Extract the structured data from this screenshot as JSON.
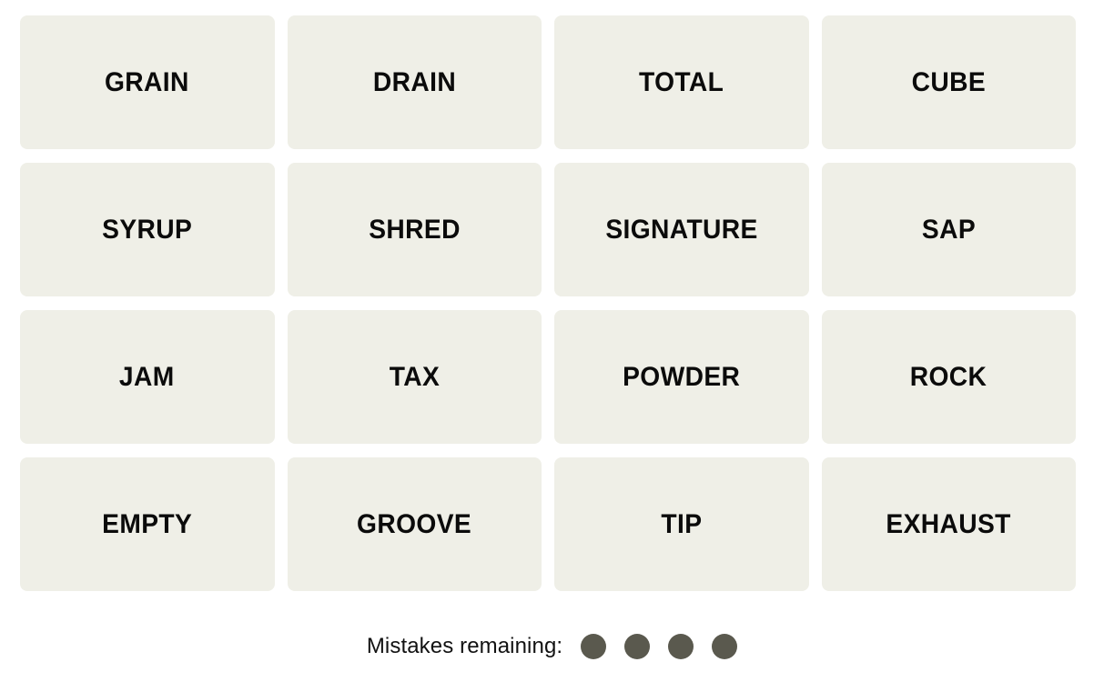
{
  "board": {
    "columns": 4,
    "rows": 4,
    "tile_color": "#EFEFE7",
    "tile_text_color": "#0B0B0B",
    "background_color": "#FFFFFF",
    "tiles": [
      {
        "word": "GRAIN"
      },
      {
        "word": "DRAIN"
      },
      {
        "word": "TOTAL"
      },
      {
        "word": "CUBE"
      },
      {
        "word": "SYRUP"
      },
      {
        "word": "SHRED"
      },
      {
        "word": "SIGNATURE"
      },
      {
        "word": "SAP"
      },
      {
        "word": "JAM"
      },
      {
        "word": "TAX"
      },
      {
        "word": "POWDER"
      },
      {
        "word": "ROCK"
      },
      {
        "word": "EMPTY"
      },
      {
        "word": "GROOVE"
      },
      {
        "word": "TIP"
      },
      {
        "word": "EXHAUST"
      }
    ]
  },
  "mistakes": {
    "label": "Mistakes remaining:",
    "remaining": 4,
    "dot_color": "#5A594E"
  }
}
